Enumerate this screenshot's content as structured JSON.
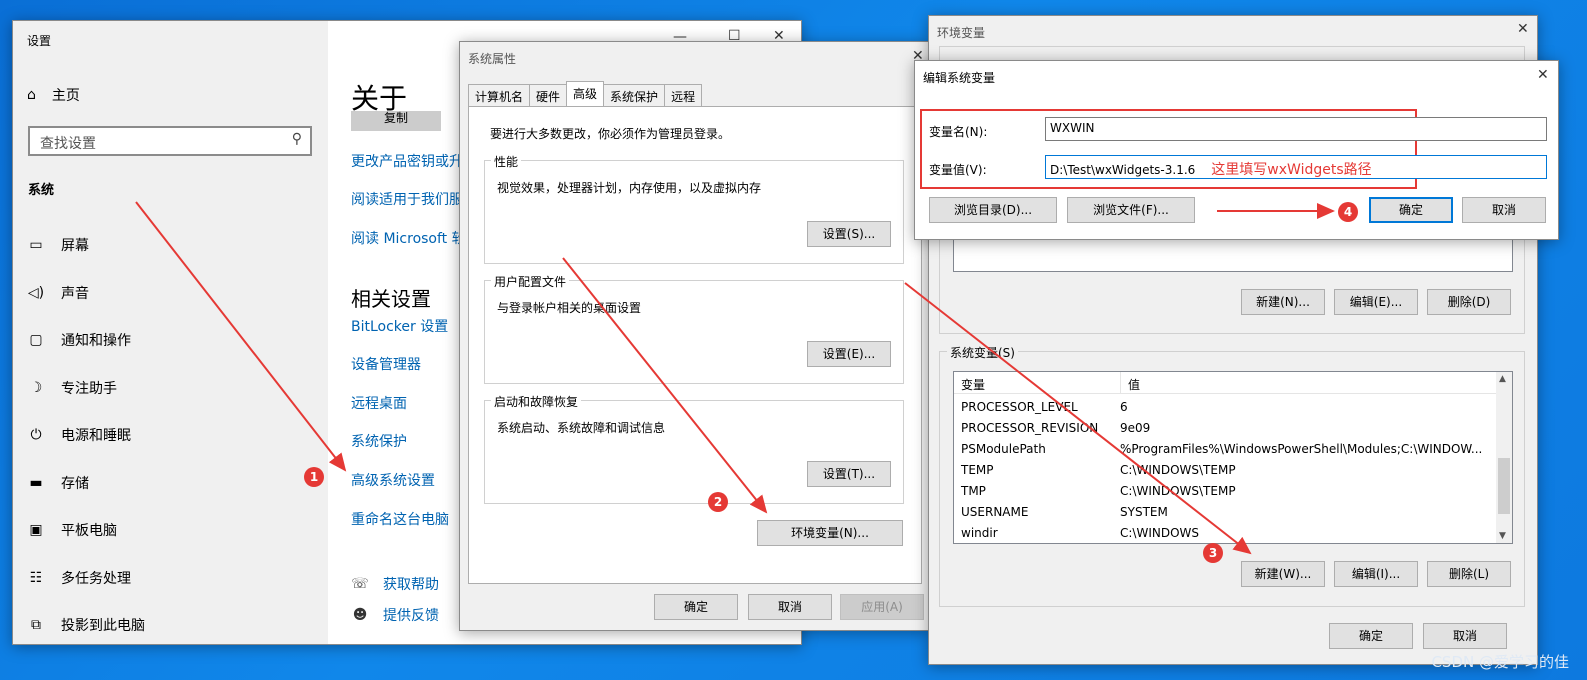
{
  "settings": {
    "title": "设置",
    "home": "主页",
    "search_placeholder": "查找设置",
    "section": "系统",
    "nav": [
      "屏幕",
      "声音",
      "通知和操作",
      "专注助手",
      "电源和睡眠",
      "存储",
      "平板电脑",
      "多任务处理",
      "投影到此电脑"
    ],
    "about_title": "关于",
    "copy_label": "复制",
    "about_links": [
      "更改产品密钥或升",
      "阅读适用于我们服",
      "阅读 Microsoft 软"
    ],
    "related_title": "相关设置",
    "related_links": [
      "BitLocker 设置",
      "设备管理器",
      "远程桌面",
      "系统保护",
      "高级系统设置",
      "重命名这台电脑"
    ],
    "help": "获取帮助",
    "feedback": "提供反馈"
  },
  "system_properties": {
    "title": "系统属性",
    "tabs": [
      "计算机名",
      "硬件",
      "高级",
      "系统保护",
      "远程"
    ],
    "admin_note": "要进行大多数更改，你必须作为管理员登录。",
    "groups": [
      {
        "label": "性能",
        "desc": "视觉效果，处理器计划，内存使用，以及虚拟内存",
        "button": "设置(S)..."
      },
      {
        "label": "用户配置文件",
        "desc": "与登录帐户相关的桌面设置",
        "button": "设置(E)..."
      },
      {
        "label": "启动和故障恢复",
        "desc": "系统启动、系统故障和调试信息",
        "button": "设置(T)..."
      }
    ],
    "env_button": "环境变量(N)...",
    "ok": "确定",
    "cancel": "取消",
    "apply": "应用(A)"
  },
  "env_vars": {
    "title": "环境变量",
    "user_buttons": [
      "新建(N)...",
      "编辑(E)...",
      "删除(D)"
    ],
    "system_label": "系统变量(S)",
    "col_var": "变量",
    "col_val": "值",
    "rows": [
      {
        "name": "PROCESSOR_LEVEL",
        "value": "6"
      },
      {
        "name": "PROCESSOR_REVISION",
        "value": "9e09"
      },
      {
        "name": "PSModulePath",
        "value": "%ProgramFiles%\\WindowsPowerShell\\Modules;C:\\WINDOW..."
      },
      {
        "name": "TEMP",
        "value": "C:\\WINDOWS\\TEMP"
      },
      {
        "name": "TMP",
        "value": "C:\\WINDOWS\\TEMP"
      },
      {
        "name": "USERNAME",
        "value": "SYSTEM"
      },
      {
        "name": "windir",
        "value": "C:\\WINDOWS"
      }
    ],
    "system_buttons": [
      "新建(W)...",
      "编辑(I)...",
      "删除(L)"
    ],
    "ok": "确定",
    "cancel": "取消"
  },
  "edit_var": {
    "title": "编辑系统变量",
    "name_label": "变量名(N):",
    "name_value": "WXWIN",
    "value_label": "变量值(V):",
    "value_value": "D:\\Test\\wxWidgets-3.1.6",
    "note": "这里填写wxWidgets路径",
    "browse_dir": "浏览目录(D)...",
    "browse_file": "浏览文件(F)...",
    "ok": "确定",
    "cancel": "取消"
  },
  "markers": [
    "1",
    "2",
    "3",
    "4"
  ],
  "watermark": "CSDN @爱学习的佳",
  "colors": {
    "annotation": "#e53935",
    "link": "#0063b1",
    "accent": "#0078d7"
  }
}
